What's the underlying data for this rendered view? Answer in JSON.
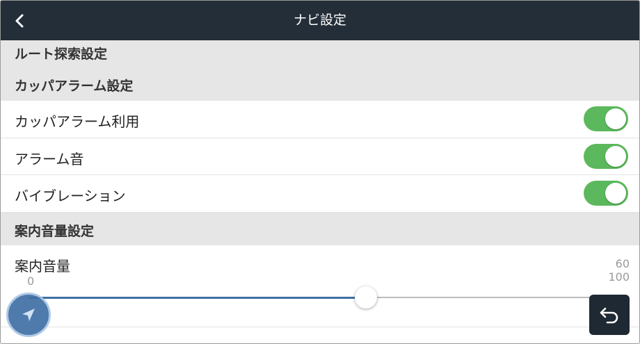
{
  "header": {
    "title": "ナビ設定",
    "back_icon": "chevron-left-icon"
  },
  "sections": {
    "route_search": "ルート探索設定",
    "kappa_alarm": "カッパアラーム設定",
    "guidance_volume": "案内音量設定"
  },
  "toggles": [
    {
      "label": "カッパアラーム利用",
      "on": true
    },
    {
      "label": "アラーム音",
      "on": true
    },
    {
      "label": "バイブレーション",
      "on": true
    }
  ],
  "volume": {
    "label": "案内音量",
    "min": "0",
    "max": "100",
    "current": "60",
    "value_fraction": 0.6
  },
  "colors": {
    "header_bg": "#242e38",
    "toggle_on": "#5cb85c",
    "slider_fill": "#3f6fa5",
    "section_bg": "#e6e6e6"
  },
  "icons": {
    "nav_fab": "navigation-arrow-icon",
    "return_button": "return-arrow-icon"
  }
}
